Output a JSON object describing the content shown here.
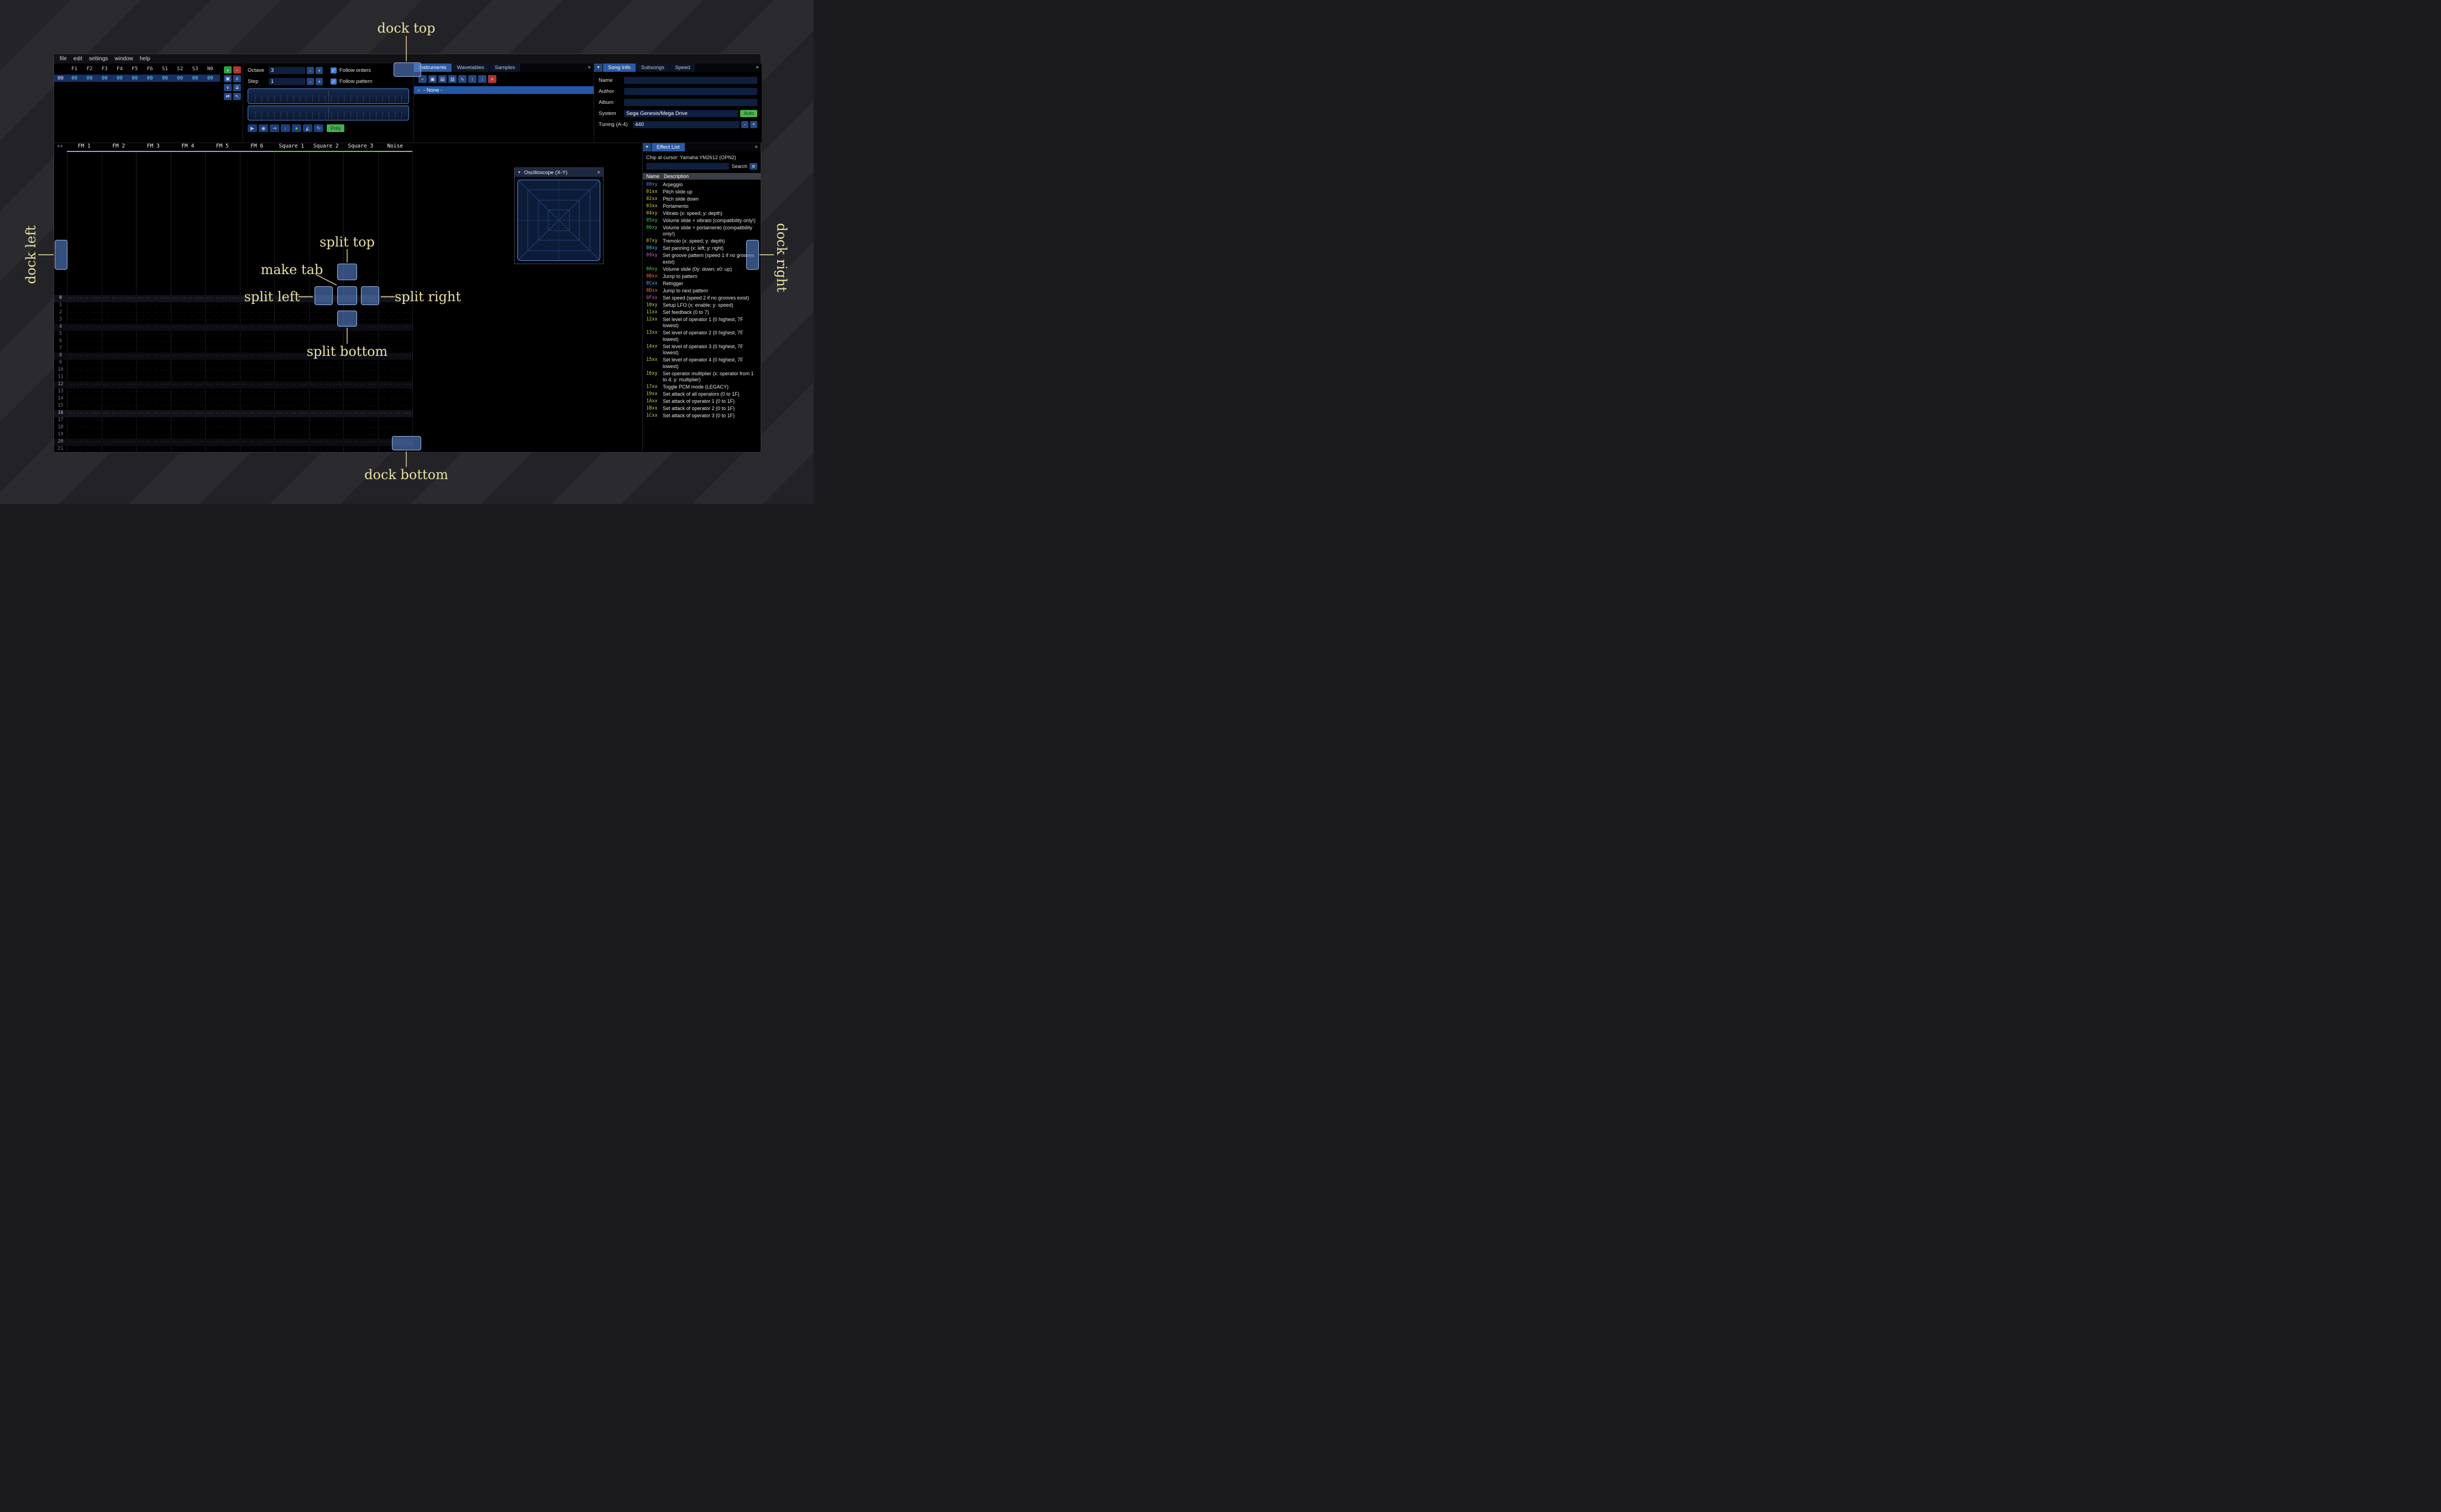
{
  "window": {
    "menu": [
      "file",
      "edit",
      "settings",
      "window",
      "help"
    ]
  },
  "orders": {
    "channels": [
      "F1",
      "F2",
      "F3",
      "F4",
      "F5",
      "F6",
      "S1",
      "S2",
      "S3",
      "N0"
    ],
    "row_index": "00",
    "row_values": [
      "00",
      "00",
      "00",
      "00",
      "00",
      "00",
      "00",
      "00",
      "00",
      "00"
    ],
    "toolbar": [
      {
        "name": "add-order-button",
        "glyph": "+",
        "style": "green"
      },
      {
        "name": "remove-order-button",
        "glyph": "−",
        "style": "red"
      },
      {
        "name": "duplicate-order-button",
        "glyph": "▣",
        "style": ""
      },
      {
        "name": "move-order-up-button",
        "glyph": "∧",
        "style": ""
      },
      {
        "name": "move-order-down-button",
        "glyph": "∨",
        "style": ""
      },
      {
        "name": "duplicate-order-end-button",
        "glyph": "⇊",
        "style": ""
      },
      {
        "name": "change-all-orders-button",
        "glyph": "⇄",
        "style": ""
      },
      {
        "name": "order-edit-mode-button",
        "glyph": "↖",
        "style": ""
      }
    ]
  },
  "transport": {
    "octave_label": "Octave",
    "octave_value": "3",
    "step_label": "Step",
    "step_value": "1",
    "minus_label": "-",
    "plus_label": "+",
    "checkmark": "✓",
    "follow_orders_label": "Follow orders",
    "follow_pattern_label": "Follow pattern",
    "buttons": [
      {
        "name": "play-button",
        "glyph": "▶"
      },
      {
        "name": "stop-button",
        "glyph": "◉"
      },
      {
        "name": "play-pattern-button",
        "glyph": "⇥"
      },
      {
        "name": "step-row-button",
        "glyph": "↓"
      },
      {
        "name": "edit-record-button",
        "glyph": "●",
        "color": "#46d446"
      },
      {
        "name": "metronome-button",
        "glyph": "◭"
      },
      {
        "name": "repeat-pattern-button",
        "glyph": "↻"
      }
    ],
    "poly_label": "Poly"
  },
  "assets": {
    "tabs": [
      "Instruments",
      "Wavetables",
      "Samples"
    ],
    "active_tab": 0,
    "close": "×",
    "toolbar": [
      {
        "name": "add-instrument-button",
        "glyph": "+",
        "style": "green-glyph"
      },
      {
        "name": "duplicate-instrument-button",
        "glyph": "▣",
        "style": ""
      },
      {
        "name": "open-instrument-button",
        "glyph": "▤",
        "style": ""
      },
      {
        "name": "save-instrument-button",
        "glyph": "▥",
        "style": ""
      },
      {
        "name": "instrument-organize-button",
        "glyph": "∿",
        "style": ""
      },
      {
        "name": "move-instrument-up-button",
        "glyph": "↑",
        "style": ""
      },
      {
        "name": "move-instrument-down-button",
        "glyph": "↓",
        "style": ""
      },
      {
        "name": "delete-instrument-button",
        "glyph": "×",
        "style": "red"
      }
    ],
    "list": [
      {
        "icon": "○",
        "label": "- None -"
      }
    ]
  },
  "song_info": {
    "collapse": "▼",
    "close": "×",
    "tabs": [
      "Song Info",
      "Subsongs",
      "Speed"
    ],
    "active_tab": 0,
    "fields": [
      {
        "label": "Name",
        "value": ""
      },
      {
        "label": "Author",
        "value": ""
      },
      {
        "label": "Album",
        "value": ""
      }
    ],
    "system_label": "System",
    "system_value": "Sega Genesis/Mega Drive",
    "auto_label": "Auto",
    "tuning_label": "Tuning (A-4)",
    "tuning_value": "440",
    "minus_label": "-",
    "plus_label": "+"
  },
  "pattern": {
    "corner_label": "++",
    "channels": [
      {
        "name": "FM 1",
        "color": "#8ea0ff"
      },
      {
        "name": "FM 2",
        "color": "#8ea0ff"
      },
      {
        "name": "FM 3",
        "color": "#8ea0ff"
      },
      {
        "name": "FM 4",
        "color": "#8ea0ff"
      },
      {
        "name": "FM 5",
        "color": "#8ea0ff"
      },
      {
        "name": "FM 6",
        "color": "#8ea0ff"
      },
      {
        "name": "Square 1",
        "color": "#58d858"
      },
      {
        "name": "Square 2",
        "color": "#58d858"
      },
      {
        "name": "Square 3",
        "color": "#58d858"
      },
      {
        "name": "Noise",
        "color": "#a8a8a8"
      }
    ],
    "row_numbers": [
      "0",
      "1",
      "2",
      "3",
      "4",
      "5",
      "6",
      "7",
      "8",
      "9",
      "10",
      "11",
      "12",
      "13",
      "14",
      "15",
      "16",
      "17",
      "18",
      "19",
      "20",
      "21"
    ],
    "empty_cell": "... .. .. ...."
  },
  "oscilloscope": {
    "collapse": "▼",
    "title": "Oscilloscope (X-Y)",
    "close": "×"
  },
  "effect_list": {
    "collapse": "▼",
    "title": "Effect List",
    "close": "×",
    "chip_line": "Chip at cursor: Yamaha YM2612 (OPN2)",
    "search_label": "Search",
    "menu_icon": "≡",
    "col_name": "Name",
    "col_description": "Description",
    "items": [
      {
        "code": "00xy",
        "color": "#5a8cff",
        "desc": "Arpeggio"
      },
      {
        "code": "01xx",
        "color": "#d0d044",
        "desc": "Pitch slide up"
      },
      {
        "code": "02xx",
        "color": "#d0d044",
        "desc": "Pitch slide down"
      },
      {
        "code": "03xx",
        "color": "#d0d044",
        "desc": "Portamento"
      },
      {
        "code": "04xy",
        "color": "#d0d044",
        "desc": "Vibrato (x: speed; y: depth)"
      },
      {
        "code": "05xy",
        "color": "#4ed45a",
        "desc": "Volume slide + vibrato (compatibility only!)"
      },
      {
        "code": "06xy",
        "color": "#4ed45a",
        "desc": "Volume slide + portamento (compatibility only!)"
      },
      {
        "code": "07xy",
        "color": "#d0d044",
        "desc": "Tremolo (x: speed; y: depth)"
      },
      {
        "code": "08xy",
        "color": "#4fc6e8",
        "desc": "Set panning (x: left; y: right)"
      },
      {
        "code": "09xy",
        "color": "#d45ad4",
        "desc": "Set groove pattern (speed 1 if no grooves exist)"
      },
      {
        "code": "0Axy",
        "color": "#4ed45a",
        "desc": "Volume slide (0y: down; x0: up)"
      },
      {
        "code": "0Bxx",
        "color": "#ff6a4a",
        "desc": "Jump to pattern"
      },
      {
        "code": "0Cxx",
        "color": "#6aa8ff",
        "desc": "Retrigger"
      },
      {
        "code": "0Dxx",
        "color": "#ff6a4a",
        "desc": "Jump to next pattern"
      },
      {
        "code": "0Fxx",
        "color": "#d45ad4",
        "desc": "Set speed (speed 2 if no grooves exist)"
      },
      {
        "code": "10xy",
        "color": "#b8d84e",
        "desc": "Setup LFO (x: enable; y: speed)"
      },
      {
        "code": "11xx",
        "color": "#b8d84e",
        "desc": "Set feedback (0 to 7)"
      },
      {
        "code": "12xx",
        "color": "#b8d84e",
        "desc": "Set level of operator 1 (0 highest, 7F lowest)"
      },
      {
        "code": "13xx",
        "color": "#b8d84e",
        "desc": "Set level of operator 2 (0 highest, 7F lowest)"
      },
      {
        "code": "14xx",
        "color": "#b8d84e",
        "desc": "Set level of operator 3 (0 highest, 7F lowest)"
      },
      {
        "code": "15xx",
        "color": "#b8d84e",
        "desc": "Set level of operator 4 (0 highest, 7F lowest)"
      },
      {
        "code": "16xy",
        "color": "#b8d84e",
        "desc": "Set operator multiplier (x: operator from 1 to 4; y: multiplier)"
      },
      {
        "code": "17xx",
        "color": "#b8d84e",
        "desc": "Toggle PCM mode (LEGACY)"
      },
      {
        "code": "19xx",
        "color": "#b8d84e",
        "desc": "Set attack of all operators (0 to 1F)"
      },
      {
        "code": "1Axx",
        "color": "#b8d84e",
        "desc": "Set attack of operator 1 (0 to 1F)"
      },
      {
        "code": "1Bxx",
        "color": "#b8d84e",
        "desc": "Set attack of operator 2 (0 to 1F)"
      },
      {
        "code": "1Cxx",
        "color": "#b8d84e",
        "desc": "Set attack of operator 3 (0 to 1F)"
      }
    ]
  },
  "annotations": {
    "dock_top": "dock top",
    "dock_left": "dock left",
    "dock_right": "dock right",
    "dock_bottom": "dock bottom",
    "split_top": "split top",
    "make_tab": "make tab",
    "split_left": "split left",
    "split_right": "split right",
    "split_bottom": "split bottom"
  }
}
